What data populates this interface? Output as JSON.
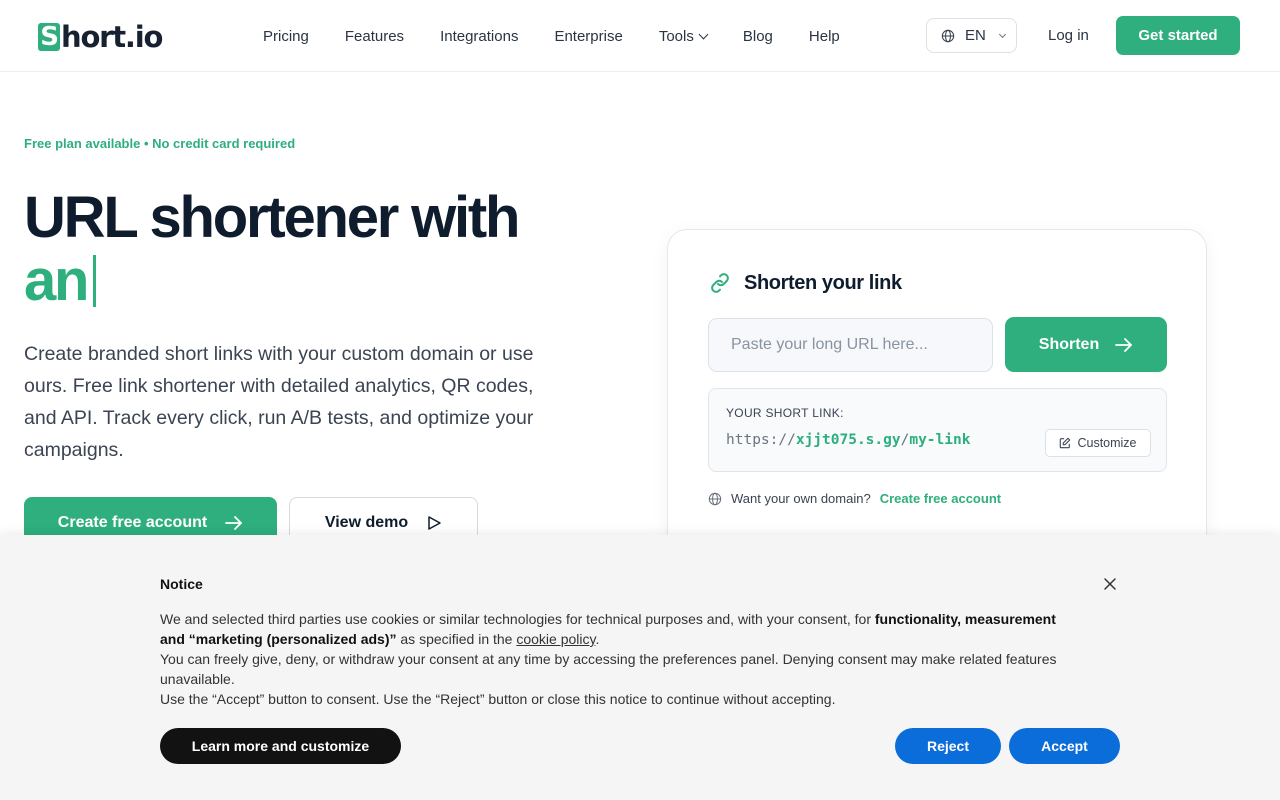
{
  "header": {
    "logo_initial": "S",
    "logo_text": "hort.io",
    "nav": [
      {
        "label": "Pricing"
      },
      {
        "label": "Features"
      },
      {
        "label": "Integrations"
      },
      {
        "label": "Enterprise"
      },
      {
        "label": "Tools"
      },
      {
        "label": "Blog"
      },
      {
        "label": "Help"
      }
    ],
    "language": "EN",
    "login_label": "Log in",
    "cta_label": "Get started"
  },
  "hero": {
    "eyebrow": "Free plan available • No credit card required",
    "title_line1": "URL shortener with",
    "title_line2": "an",
    "description": "Create branded short links with your custom domain or use ours. Free link shortener with detailed analytics, QR codes, and API. Track every click, run A/B tests, and optimize your campaigns.",
    "primary_button": "Create free account",
    "secondary_button": "View demo"
  },
  "shortener": {
    "title": "Shorten your link",
    "input_placeholder": "Paste your long URL here...",
    "button_label": "Shorten",
    "result_label": "YOUR SHORT LINK:",
    "result_prefix": "https://",
    "result_domain": "xjjt075.s.gy",
    "result_slash": "/",
    "result_slug": "my-link",
    "customize_label": "Customize",
    "domain_prompt": "Want your own domain?",
    "domain_cta": "Create free account"
  },
  "cookie_notice": {
    "title": "Notice",
    "text_p1_a": "We and selected third parties use cookies or similar technologies for technical purposes and, with your consent, for ",
    "text_p1_bold": "functionality, measurement and “marketing (personalized ads)”",
    "text_p1_b": " as specified in the ",
    "text_p1_link": "cookie policy",
    "text_p1_end": ".",
    "text_p2": "You can freely give, deny, or withdraw your consent at any time by accessing the preferences panel. Denying consent may make related features unavailable.",
    "text_p3": "Use the “Accept” button to consent. Use the “Reject” button or close this notice to continue without accepting.",
    "learn_more_label": "Learn more and customize",
    "reject_label": "Reject",
    "accept_label": "Accept"
  },
  "colors": {
    "brand_green": "#2eaf7d",
    "heading_dark": "#0f1c2e",
    "consent_blue": "#0b6dd9",
    "consent_dark": "#121212"
  }
}
